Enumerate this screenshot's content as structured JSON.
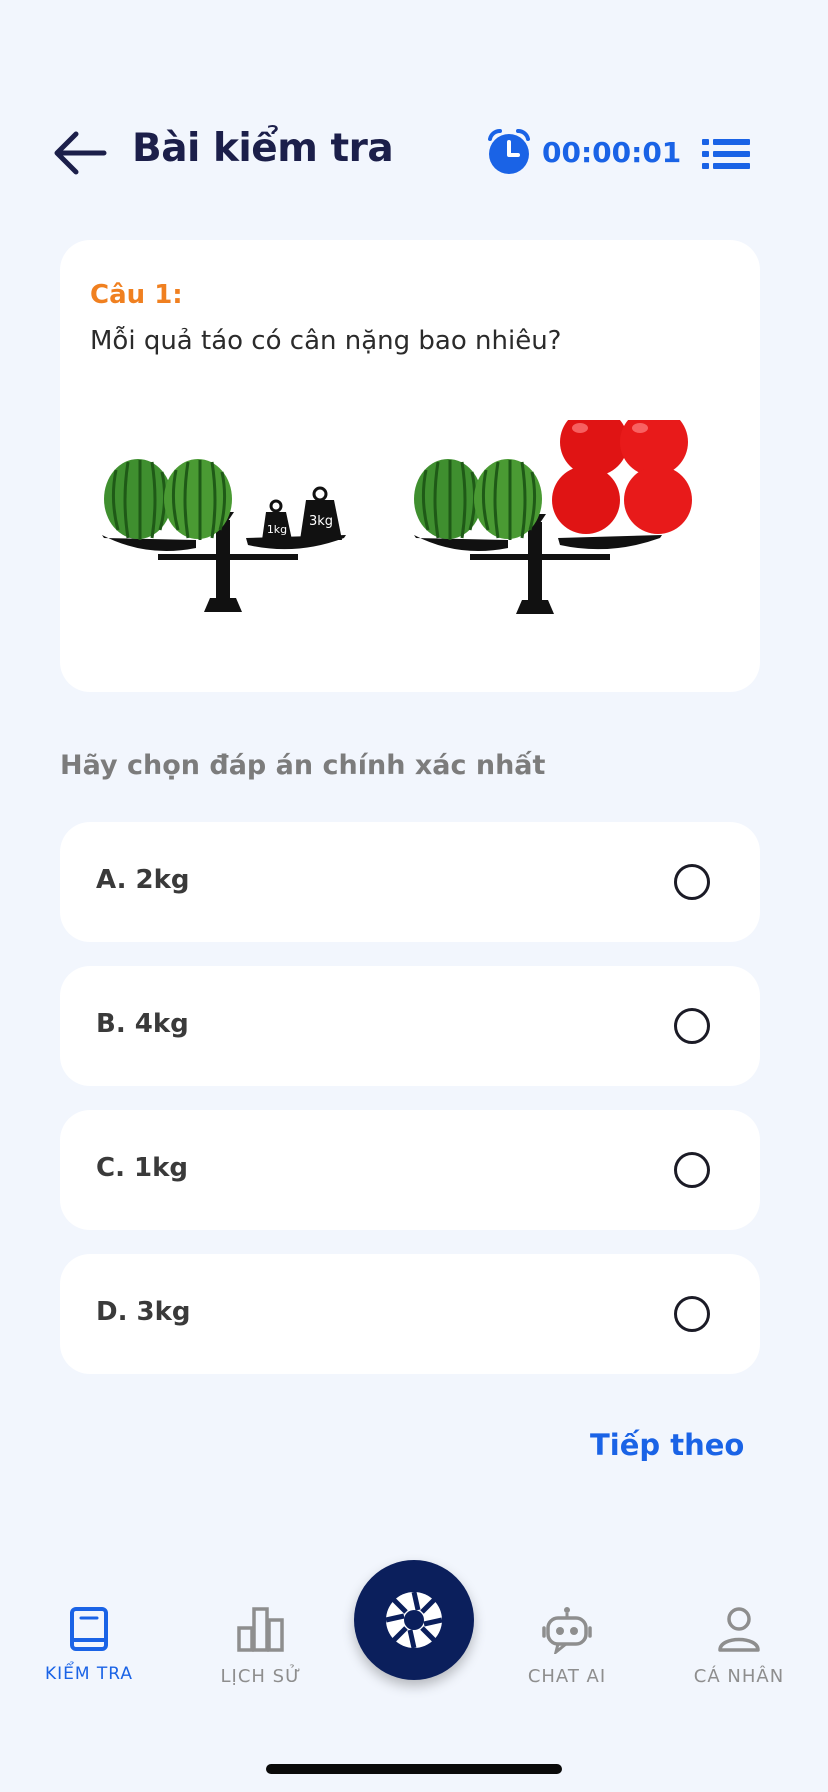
{
  "header": {
    "title": "Bài kiểm tra",
    "timer": "00:00:01",
    "accent_color": "#1a63e6"
  },
  "question": {
    "number_label": "Câu 1:",
    "text": "Mỗi quả táo có cân nặng bao nhiêu?",
    "weights": [
      "1kg",
      "3kg"
    ]
  },
  "instruction": "Hãy chọn đáp án chính xác nhất",
  "options": [
    {
      "label": "A. 2kg"
    },
    {
      "label": "B. 4kg"
    },
    {
      "label": "C. 1kg"
    },
    {
      "label": "D. 3kg"
    }
  ],
  "next_label": "Tiếp theo",
  "nav": {
    "items": [
      {
        "label": "KIỂM TRA",
        "icon": "book-icon",
        "active": true
      },
      {
        "label": "LỊCH SỬ",
        "icon": "bar-chart-icon",
        "active": false
      },
      {
        "label": "CHAT AI",
        "icon": "robot-icon",
        "active": false
      },
      {
        "label": "CÁ NHÂN",
        "icon": "user-icon",
        "active": false
      }
    ],
    "center_icon": "aperture-icon"
  }
}
